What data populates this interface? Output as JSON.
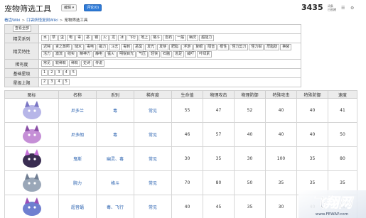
{
  "header": {
    "title": "宠物筛选工具",
    "edit_label": "编辑",
    "discuss_label": "评论(0)",
    "count": "3435",
    "count_note_1": "词条",
    "count_note_2": "已创建"
  },
  "breadcrumb": {
    "home": "看齿Wiki",
    "parent": "口袋妖怪复刻Wiki",
    "current": "宠物筛选工具"
  },
  "filters": {
    "view_all": "查看全部",
    "type_label": "精灵系列",
    "types": [
      "水",
      "草",
      "虫",
      "电",
      "毒",
      "恶",
      "钢",
      "火",
      "龙",
      "冰",
      "飞行",
      "地上",
      "格斗",
      "岩石",
      "一般",
      "幽灵",
      "超能力"
    ],
    "ability_label": "精灵特性",
    "abilities": [
      "迟钝",
      "贪之蒸照",
      "储水",
      "毒电",
      "磁力",
      "斗志",
      "毒刺",
      "恶臭",
      "发光",
      "发芽",
      "肥脂",
      "浮游",
      "复眼",
      "隔音",
      "根性",
      "怪力剪刀",
      "怪力钳",
      "厚脂肪",
      "换装",
      "活力",
      "激流",
      "结实",
      "精神力",
      "静电",
      "猛火",
      "明锐目光",
      "气压",
      "轻快",
      "石脑",
      "逃足",
      "威吓",
      "叶绿素"
    ],
    "rarity_label": "稀有度",
    "rarities": [
      "常见",
      "较稀有",
      "稀有",
      "史诗",
      "传说"
    ],
    "base_star_label": "基础星级",
    "base_stars": [
      "1",
      "2",
      "3",
      "4",
      "5"
    ],
    "max_star_label": "星级上限",
    "max_stars": [
      "2",
      "3",
      "4",
      "5"
    ]
  },
  "table": {
    "headers": [
      "图标",
      "名称",
      "系别",
      "稀有度",
      "生命值",
      "物理攻击",
      "物理防御",
      "特殊攻击",
      "特殊防御",
      "速度"
    ],
    "rows": [
      {
        "name": "尼多兰",
        "type": "毒",
        "rarity": "常见",
        "hp": "55",
        "atk": "47",
        "def": "52",
        "spatk": "40",
        "spdef": "40",
        "speed": "41",
        "color": "#b7b6e8",
        "accent": "#7a76c4"
      },
      {
        "name": "尼多朗",
        "type": "毒",
        "rarity": "常见",
        "hp": "46",
        "spatk": "40",
        "atk": "57",
        "def": "40",
        "spdef": "40",
        "speed": "50",
        "color": "#c58fd6",
        "accent": "#8a4fa6"
      },
      {
        "name": "鬼斯",
        "type": "幽灵、毒",
        "rarity": "常见",
        "hp": "30",
        "atk": "35",
        "def": "30",
        "spatk": "100",
        "spdef": "35",
        "speed": "80",
        "color": "#3a2d52",
        "accent": "#c46fd8"
      },
      {
        "name": "腕力",
        "type": "格斗",
        "rarity": "常见",
        "hp": "70",
        "atk": "80",
        "def": "50",
        "spatk": "35",
        "spdef": "35",
        "speed": "35",
        "color": "#9aa7b8",
        "accent": "#6f7d92"
      },
      {
        "name": "超音蝠",
        "type": "毒、飞行",
        "rarity": "常见",
        "hp": "40",
        "atk": "45",
        "def": "35",
        "spatk": "30",
        "spdef": "40",
        "speed": "55",
        "color": "#6f7fd0",
        "accent": "#9b4fb8"
      }
    ]
  },
  "watermark": {
    "brand": "飞翔网",
    "url": "www.FEWAP.com"
  }
}
